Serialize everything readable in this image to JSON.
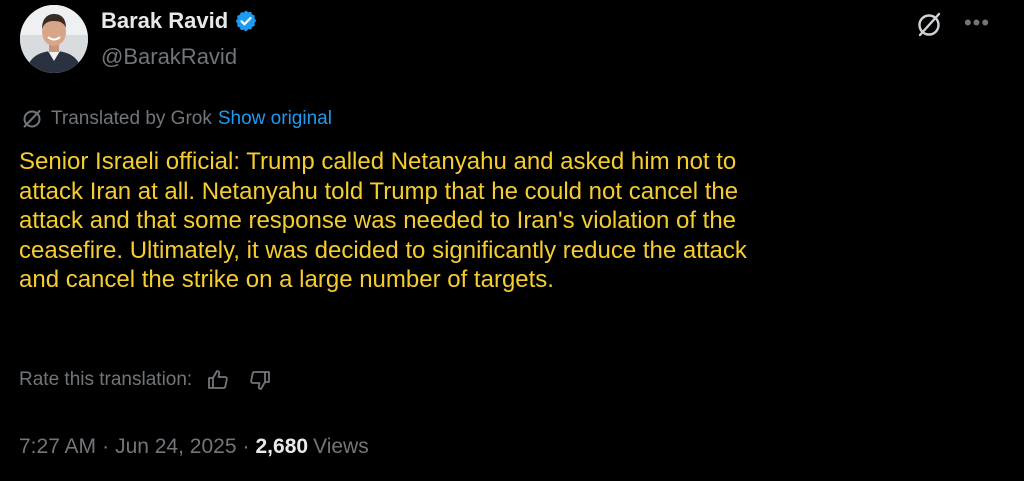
{
  "author": {
    "display_name": "Barak Ravid",
    "handle": "@BarakRavid",
    "verified": true
  },
  "translation": {
    "label": "Translated by Grok",
    "show_original": "Show original"
  },
  "tweet": {
    "text": "Senior Israeli official: Trump called Netanyahu and asked him not to\nattack Iran at all. Netanyahu told Trump that he could not cancel the\nattack and that some response was needed to Iran's violation of the\nceasefire. Ultimately, it was decided to significantly reduce the attack\nand cancel the strike on a large number of targets."
  },
  "rating": {
    "label": "Rate this translation:"
  },
  "meta": {
    "time": "7:27 AM",
    "date": "Jun 24, 2025",
    "separator": "·",
    "views_count": "2,680",
    "views_label": "Views"
  },
  "icons": {
    "verified": "verified-badge-icon",
    "grok": "grok-icon",
    "more": "more-icon",
    "thumbs_up": "thumbs-up-icon",
    "thumbs_down": "thumbs-down-icon"
  },
  "colors": {
    "background": "#000000",
    "text_primary": "#e7e9ea",
    "text_secondary": "#71767b",
    "link": "#1d9bf0",
    "translated_text": "#f5cd2f",
    "verified": "#1d9bf0"
  }
}
